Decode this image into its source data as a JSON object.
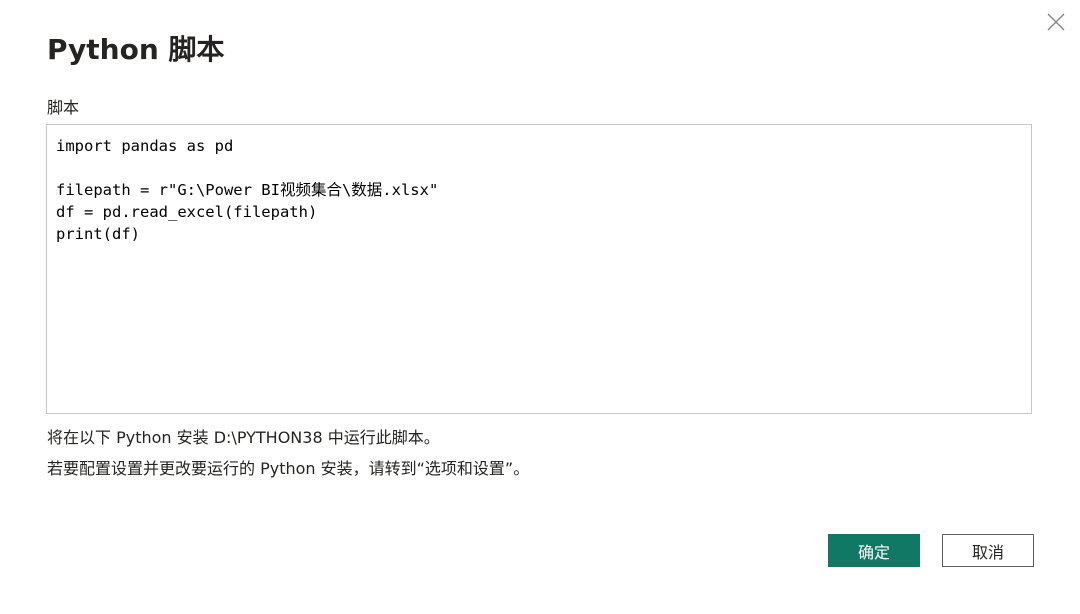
{
  "dialog": {
    "title": "Python 脚本",
    "close_icon": "close-icon"
  },
  "editor": {
    "label": "脚本",
    "lines": [
      "import pandas as pd",
      "",
      "filepath = r\"G:\\Power BI视频集合\\数据.xlsx\"",
      "df = pd.read_excel(filepath)",
      "print(df)"
    ]
  },
  "info": {
    "line1": "将在以下 Python 安装 D:\\PYTHON38 中运行此脚本。",
    "line2": "若要配置设置并更改要运行的 Python 安装，请转到“选项和设置”。"
  },
  "buttons": {
    "ok_label": "确定",
    "cancel_label": "取消"
  },
  "colors": {
    "primary": "#117865",
    "text": "#252423",
    "border": "#c8c6c4"
  }
}
